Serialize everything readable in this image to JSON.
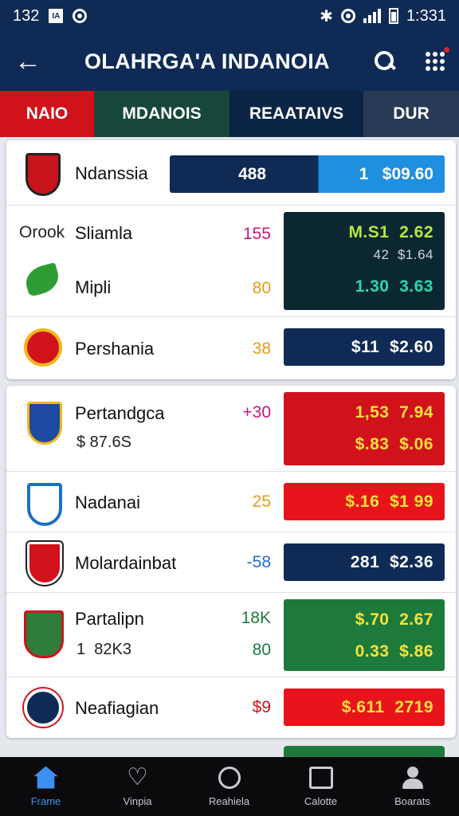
{
  "status": {
    "time": "132",
    "badge": "IA",
    "clock": "1:331"
  },
  "header": {
    "title": "OLAHRGA'A INDANOIA"
  },
  "tabs": [
    "NAIO",
    "MDANOIS",
    "REAATAIVS",
    "DUR"
  ],
  "rows": [
    {
      "name": "Ndanssia",
      "left_value": "488",
      "right_value": "1   $09.60"
    },
    {
      "prefix": "Orook",
      "name": "Sliamla",
      "mid": "155",
      "odds": [
        "M.S1  2.62",
        "42  $1.64"
      ]
    },
    {
      "name": "Mipli",
      "mid": "80",
      "odds": [
        "1.30  3.63"
      ]
    },
    {
      "name": "Pershania",
      "mid": "38",
      "odds": [
        "$11  $2.60"
      ]
    },
    {
      "name": "Pertandgca",
      "sub": "$ 87.6S",
      "mid": "+30",
      "odds": [
        "1,53  7.94",
        "$.83  $.06"
      ]
    },
    {
      "name": "Nadanai",
      "mid": "25",
      "odds": [
        "$.16  $1 99"
      ]
    },
    {
      "name": "Molardainbat",
      "mid": "-58",
      "odds": [
        "281  $2.36"
      ]
    },
    {
      "name": "Partalipn",
      "sub": "1  82K3",
      "mid": "18K",
      "mid2": "80",
      "odds": [
        "$.70  2.67",
        "0.33  $.86"
      ]
    },
    {
      "name": "Neafiagian",
      "mid": "$9",
      "odds": [
        "$.611  2719"
      ]
    }
  ],
  "nav": [
    "Frame",
    "Vinpia",
    "Reahiela",
    "Calotte",
    "Boarats"
  ],
  "colors": {
    "navy": "#0f2a55",
    "red": "#d1121b",
    "green": "#1e7a3a",
    "blue_accent": "#3f8ff0"
  }
}
